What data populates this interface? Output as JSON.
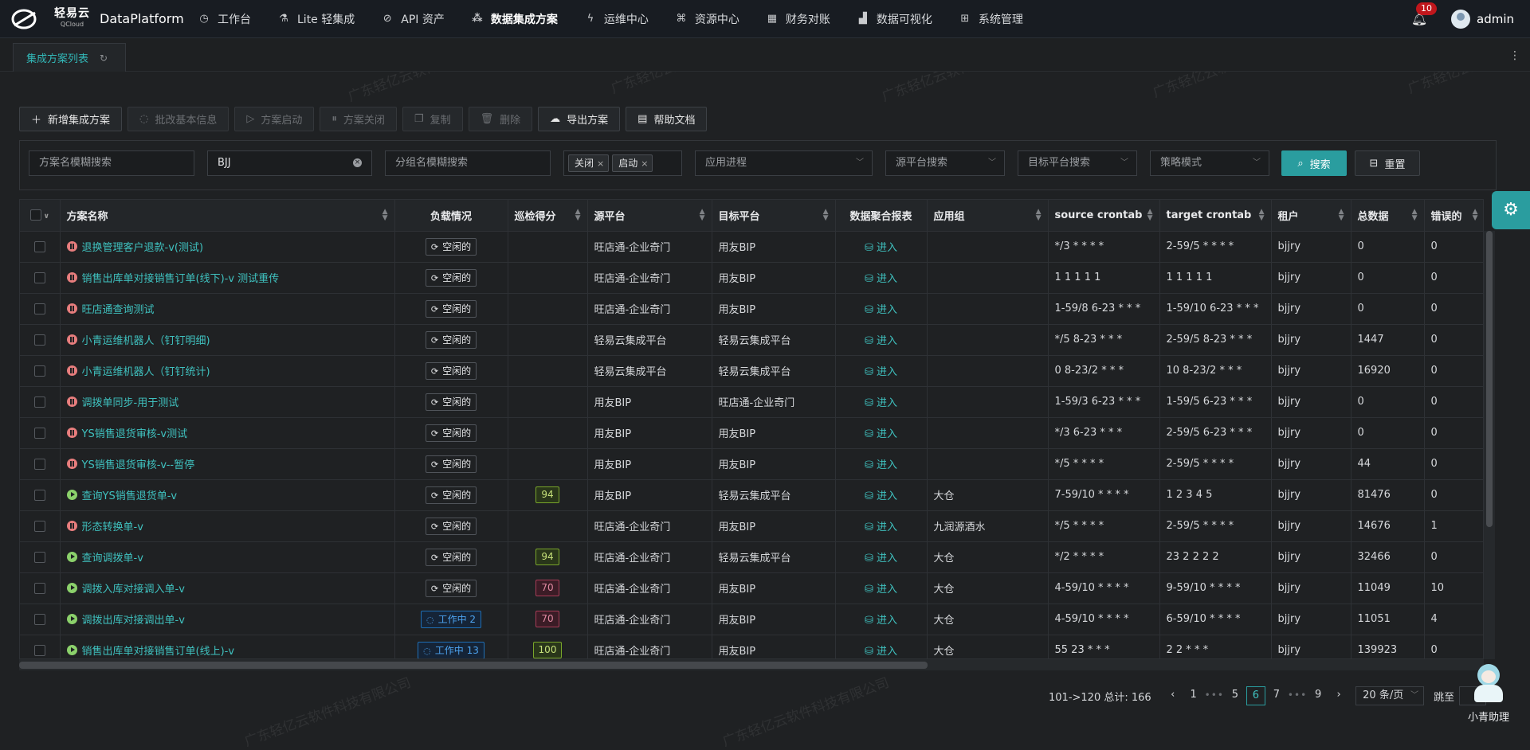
{
  "app": {
    "logo_text": "轻易云",
    "logo_sub": "QCloud",
    "platform": "DataPlatform",
    "notifications": "10",
    "username": "admin"
  },
  "nav": [
    {
      "label": "工作台",
      "icon": "clock-icon"
    },
    {
      "label": "Lite 轻集成",
      "icon": "sparkle-icon"
    },
    {
      "label": "API 资产",
      "icon": "compass-icon"
    },
    {
      "label": "数据集成方案",
      "icon": "nodes-icon",
      "active": true
    },
    {
      "label": "运维中心",
      "icon": "lightning-icon"
    },
    {
      "label": "资源中心",
      "icon": "tree-icon"
    },
    {
      "label": "财务对账",
      "icon": "calculator-icon"
    },
    {
      "label": "数据可视化",
      "icon": "chart-icon"
    },
    {
      "label": "系统管理",
      "icon": "grid-icon"
    }
  ],
  "tab": {
    "label": "集成方案列表"
  },
  "toolbar": {
    "add": "新增集成方案",
    "batch_edit": "批改基本信息",
    "start": "方案启动",
    "close": "方案关闭",
    "copy": "复制",
    "delete": "删除",
    "export": "导出方案",
    "help": "帮助文档"
  },
  "filters": {
    "name_placeholder": "方案名模糊搜索",
    "keyword_value": "BJJ",
    "group_placeholder": "分组名模糊搜索",
    "status_chips": [
      "关闭",
      "启动"
    ],
    "process_placeholder": "应用进程",
    "source_placeholder": "源平台搜索",
    "target_placeholder": "目标平台搜索",
    "strategy_placeholder": "策略模式",
    "search": "搜索",
    "reset": "重置"
  },
  "table": {
    "headers": {
      "name": "方案名称",
      "load": "负载情况",
      "score": "巡检得分",
      "source": "源平台",
      "target": "目标平台",
      "report": "数据聚合报表",
      "group": "应用组",
      "source_cron": "source crontab",
      "target_cron": "target crontab",
      "tenant": "租户",
      "total": "总数据",
      "errors": "错误的"
    },
    "rows": [
      {
        "status": "paused",
        "name": "退换管理客户退款-v(测试)",
        "load": "空闲的",
        "load_state": "idle",
        "score": "",
        "source": "旺店通-企业奇门",
        "target": "用友BIP",
        "report": "进入",
        "group": "",
        "source_cron": "*/3 * * * *",
        "target_cron": "2-59/5 * * * *",
        "tenant": "bjjry",
        "total": "0",
        "errors": "0"
      },
      {
        "status": "paused",
        "name": "销售出库单对接销售订单(线下)-v 测试重传",
        "load": "空闲的",
        "load_state": "idle",
        "score": "",
        "source": "旺店通-企业奇门",
        "target": "用友BIP",
        "report": "进入",
        "group": "",
        "source_cron": "1 1 1 1 1",
        "target_cron": "1 1 1 1 1",
        "tenant": "bjjry",
        "total": "0",
        "errors": "0"
      },
      {
        "status": "paused",
        "name": "旺店通查询测试",
        "load": "空闲的",
        "load_state": "idle",
        "score": "",
        "source": "旺店通-企业奇门",
        "target": "用友BIP",
        "report": "进入",
        "group": "",
        "source_cron": "1-59/8 6-23 * * *",
        "target_cron": "1-59/10 6-23 * * *",
        "tenant": "bjjry",
        "total": "0",
        "errors": "0"
      },
      {
        "status": "paused",
        "name": "小青运维机器人（钉钉明细)",
        "load": "空闲的",
        "load_state": "idle",
        "score": "",
        "source": "轻易云集成平台",
        "target": "轻易云集成平台",
        "report": "进入",
        "group": "",
        "source_cron": "*/5 8-23 * * *",
        "target_cron": "2-59/5 8-23 * * *",
        "tenant": "bjjry",
        "total": "1447",
        "errors": "0"
      },
      {
        "status": "paused",
        "name": "小青运维机器人（钉钉统计)",
        "load": "空闲的",
        "load_state": "idle",
        "score": "",
        "source": "轻易云集成平台",
        "target": "轻易云集成平台",
        "report": "进入",
        "group": "",
        "source_cron": "0 8-23/2 * * *",
        "target_cron": "10 8-23/2 * * *",
        "tenant": "bjjry",
        "total": "16920",
        "errors": "0"
      },
      {
        "status": "paused",
        "name": "调拨单同步-用于测试",
        "load": "空闲的",
        "load_state": "idle",
        "score": "",
        "source": "用友BIP",
        "target": "旺店通-企业奇门",
        "report": "进入",
        "group": "",
        "source_cron": "1-59/3 6-23 * * *",
        "target_cron": "1-59/5 6-23 * * *",
        "tenant": "bjjry",
        "total": "0",
        "errors": "0"
      },
      {
        "status": "paused",
        "name": "YS销售退货审核-v测试",
        "load": "空闲的",
        "load_state": "idle",
        "score": "",
        "source": "用友BIP",
        "target": "用友BIP",
        "report": "进入",
        "group": "",
        "source_cron": "*/3 6-23 * * *",
        "target_cron": "2-59/5 6-23 * * *",
        "tenant": "bjjry",
        "total": "0",
        "errors": "0"
      },
      {
        "status": "paused",
        "name": "YS销售退货审核-v--暂停",
        "load": "空闲的",
        "load_state": "idle",
        "score": "",
        "source": "用友BIP",
        "target": "用友BIP",
        "report": "进入",
        "group": "",
        "source_cron": "*/5 * * * *",
        "target_cron": "2-59/5 * * * *",
        "tenant": "bjjry",
        "total": "44",
        "errors": "0"
      },
      {
        "status": "running",
        "name": "查询YS销售退货单-v",
        "load": "空闲的",
        "load_state": "idle",
        "score": "94",
        "score_state": "good",
        "source": "用友BIP",
        "target": "轻易云集成平台",
        "report": "进入",
        "group": "大仓",
        "source_cron": "7-59/10 * * * *",
        "target_cron": "1 2 3 4 5",
        "tenant": "bjjry",
        "total": "81476",
        "errors": "0"
      },
      {
        "status": "paused",
        "name": "形态转换单-v",
        "load": "空闲的",
        "load_state": "idle",
        "score": "",
        "source": "旺店通-企业奇门",
        "target": "用友BIP",
        "report": "进入",
        "group": "九润源酒水",
        "source_cron": "*/5 * * * *",
        "target_cron": "2-59/5 * * * *",
        "tenant": "bjjry",
        "total": "14676",
        "errors": "1"
      },
      {
        "status": "running",
        "name": "查询调拨单-v",
        "load": "空闲的",
        "load_state": "idle",
        "score": "94",
        "score_state": "good",
        "source": "旺店通-企业奇门",
        "target": "轻易云集成平台",
        "report": "进入",
        "group": "大仓",
        "source_cron": "*/2 * * * *",
        "target_cron": "23 2 2 2 2",
        "tenant": "bjjry",
        "total": "32466",
        "errors": "0"
      },
      {
        "status": "running",
        "name": "调拨入库对接调入单-v",
        "load": "空闲的",
        "load_state": "idle",
        "score": "70",
        "score_state": "bad",
        "source": "旺店通-企业奇门",
        "target": "用友BIP",
        "report": "进入",
        "group": "大仓",
        "source_cron": "4-59/10 * * * *",
        "target_cron": "9-59/10 * * * *",
        "tenant": "bjjry",
        "total": "11049",
        "errors": "10"
      },
      {
        "status": "running",
        "name": "调拨出库对接调出单-v",
        "load": "工作中 2",
        "load_state": "working",
        "score": "70",
        "score_state": "bad",
        "source": "旺店通-企业奇门",
        "target": "用友BIP",
        "report": "进入",
        "group": "大仓",
        "source_cron": "4-59/10 * * * *",
        "target_cron": "6-59/10 * * * *",
        "tenant": "bjjry",
        "total": "11051",
        "errors": "4"
      },
      {
        "status": "running",
        "name": "销售出库单对接销售订单(线上)-v",
        "load": "工作中 13",
        "load_state": "working",
        "score": "100",
        "score_state": "good",
        "source": "旺店通-企业奇门",
        "target": "用友BIP",
        "report": "进入",
        "group": "大仓",
        "source_cron": "55 23 * * *",
        "target_cron": "2 2 * * *",
        "tenant": "bjjry",
        "total": "139923",
        "errors": "0"
      }
    ]
  },
  "pagination": {
    "summary": "101->120 总计: 166",
    "pages": [
      "1",
      "5",
      "6",
      "7",
      "9"
    ],
    "current": "6",
    "page_size": "20 条/页",
    "jump_label": "跳至"
  },
  "assistant": {
    "label": "小青助理"
  },
  "watermark": "广东轻亿云软件科技有限公司"
}
